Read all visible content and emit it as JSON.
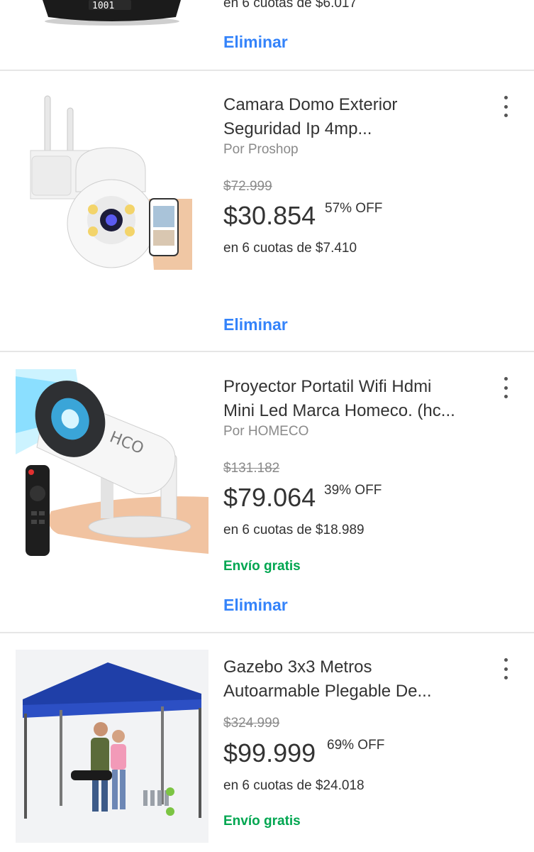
{
  "items": [
    {
      "installments": "en 6 cuotas de $6.017",
      "remove_label": "Eliminar"
    },
    {
      "title_line1": "Camara Domo Exterior",
      "title_line2": "Seguridad Ip 4mp...",
      "seller": "Por Proshop",
      "old_price": "$72.999",
      "price": "$30.854",
      "discount": "57% OFF",
      "installments": "en 6 cuotas de $7.410",
      "remove_label": "Eliminar",
      "more_icon": "more-vertical-icon"
    },
    {
      "title_line1": "Proyector Portatil Wifi Hdmi",
      "title_line2": "Mini Led Marca Homeco. (hc...",
      "seller": "Por HOMECO",
      "old_price": "$131.182",
      "price": "$79.064",
      "discount": "39% OFF",
      "installments": "en 6 cuotas de $18.989",
      "shipping": "Envío gratis",
      "remove_label": "Eliminar",
      "more_icon": "more-vertical-icon",
      "brand_text": "HCO"
    },
    {
      "title_line1": "Gazebo 3x3 Metros",
      "title_line2": "Autoarmable Plegable De...",
      "old_price": "$324.999",
      "price": "$99.999",
      "discount": "69% OFF",
      "installments": "en 6 cuotas de $24.018",
      "shipping": "Envío gratis",
      "more_icon": "more-vertical-icon"
    }
  ],
  "colors": {
    "link": "#3483fa",
    "free_shipping": "#00a650",
    "divider": "#e6e6e6",
    "gazebo_canopy": "#1f3fa8"
  }
}
